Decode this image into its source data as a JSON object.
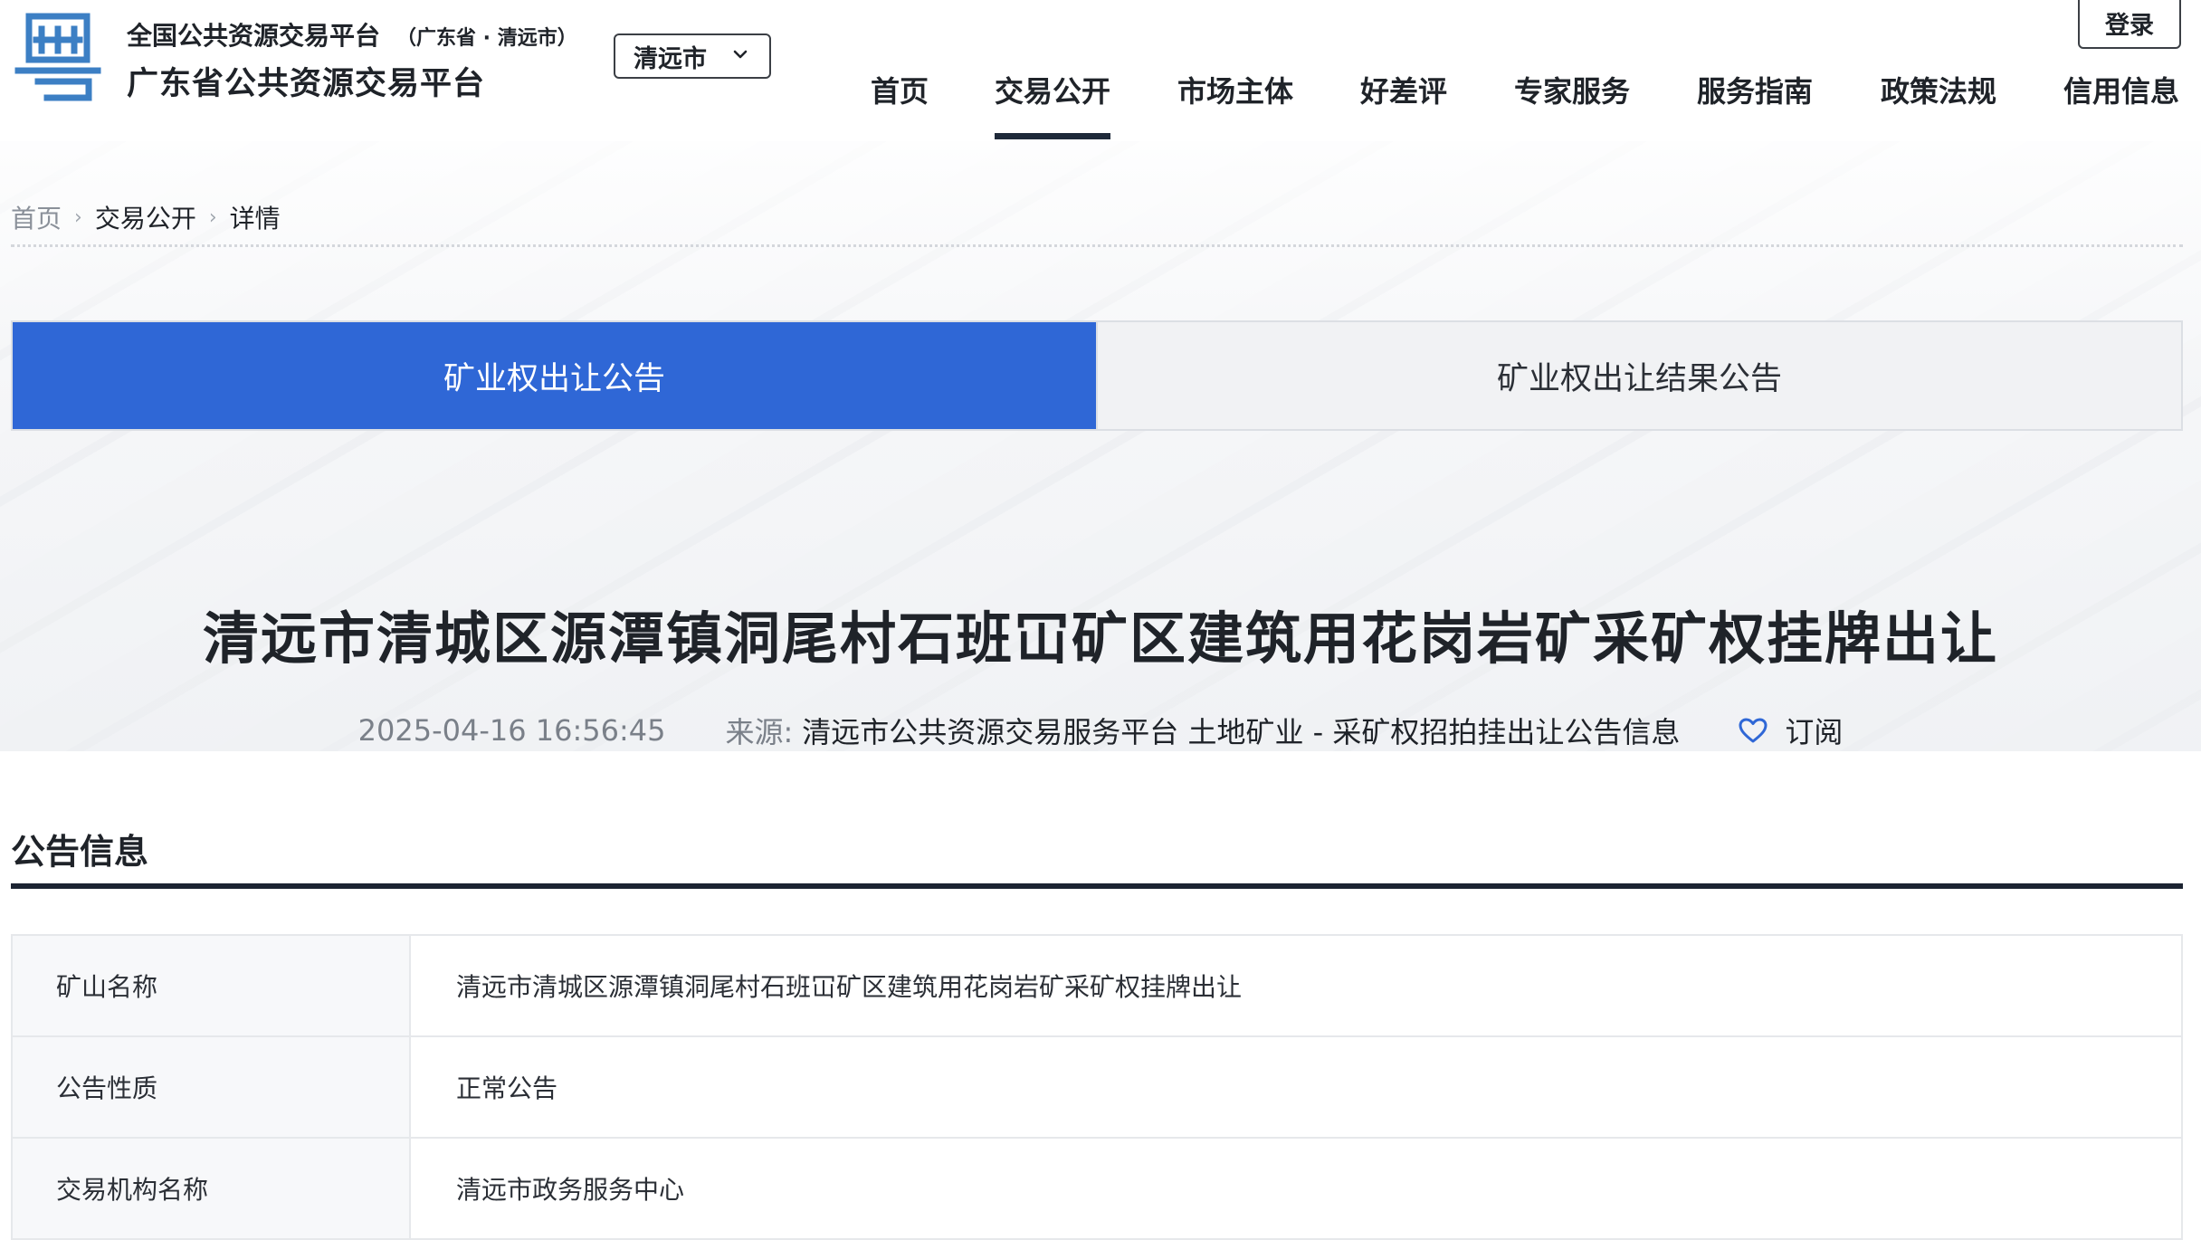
{
  "header": {
    "brand_top": "全国公共资源交易平台",
    "brand_sub": "（广东省 · 清远市）",
    "brand_main": "广东省公共资源交易平台",
    "city_select": "清远市",
    "login": "登录",
    "nav": [
      {
        "label": "首页",
        "active": false
      },
      {
        "label": "交易公开",
        "active": true
      },
      {
        "label": "市场主体",
        "active": false
      },
      {
        "label": "好差评",
        "active": false
      },
      {
        "label": "专家服务",
        "active": false
      },
      {
        "label": "服务指南",
        "active": false
      },
      {
        "label": "政策法规",
        "active": false
      },
      {
        "label": "信用信息",
        "active": false
      }
    ]
  },
  "breadcrumb": {
    "home": "首页",
    "section": "交易公开",
    "current": "详情"
  },
  "tabs": [
    {
      "label": "矿业权出让公告",
      "active": true
    },
    {
      "label": "矿业权出让结果公告",
      "active": false
    }
  ],
  "article": {
    "title": "清远市清城区源潭镇洞尾村石班冚矿区建筑用花岗岩矿采矿权挂牌出让",
    "date": "2025-04-16 16:56:45",
    "source_label": "来源:",
    "source": "清远市公共资源交易服务平台 土地矿业 - 采矿权招拍挂出让公告信息",
    "subscribe": "订阅"
  },
  "section": {
    "title": "公告信息",
    "rows": [
      {
        "key": "矿山名称",
        "value": "清远市清城区源潭镇洞尾村石班冚矿区建筑用花岗岩矿采矿权挂牌出让"
      },
      {
        "key": "公告性质",
        "value": "正常公告"
      },
      {
        "key": "交易机构名称",
        "value": "清远市政务服务中心"
      }
    ]
  },
  "colors": {
    "accent": "#2f67d6",
    "nav_underline": "#1f2a3a",
    "logo": "#3c7fc4"
  }
}
